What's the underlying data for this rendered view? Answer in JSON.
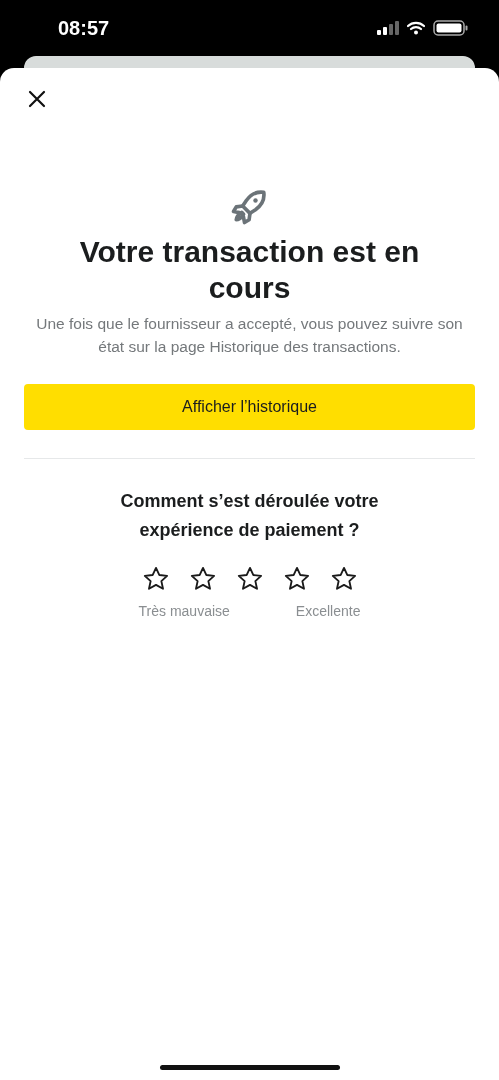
{
  "status_bar": {
    "time": "08:57"
  },
  "title": "Votre transaction est en cours",
  "message": "Une fois que le fournisseur a accepté, vous pouvez suivre son état sur la page Historique des transactions.",
  "primary_button": "Afficher l’historique",
  "rating": {
    "question": "Comment s’est déroulée votre expérience de paiement ?",
    "stars": 0,
    "low_label": "Très mauvaise",
    "high_label": "Excellente"
  }
}
